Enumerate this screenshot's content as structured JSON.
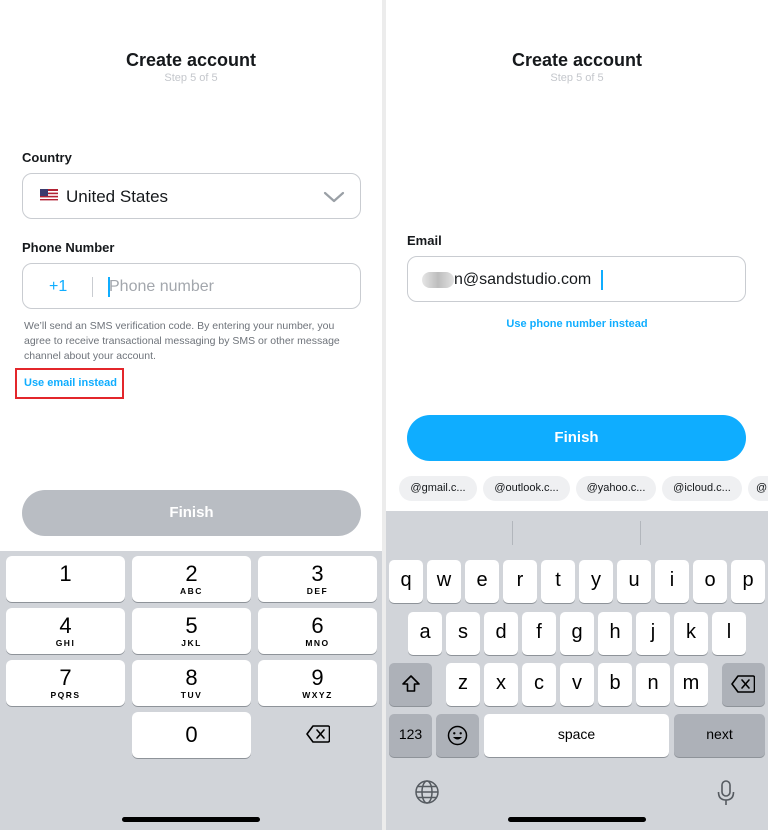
{
  "left": {
    "title": "Create account",
    "subtitle": "Step 5 of 5",
    "country_label": "Country",
    "country_value": "United States",
    "phone_label": "Phone Number",
    "country_code": "+1",
    "phone_placeholder": "Phone number",
    "sms_note": "We’ll send an SMS verification code. By entering your number, you agree to receive transactional messaging by SMS or other message channel about your account.",
    "use_email_link": "Use email instead",
    "finish_label": "Finish",
    "numpad": [
      {
        "num": "1",
        "letters": ""
      },
      {
        "num": "2",
        "letters": "ABC"
      },
      {
        "num": "3",
        "letters": "DEF"
      },
      {
        "num": "4",
        "letters": "GHI"
      },
      {
        "num": "5",
        "letters": "JKL"
      },
      {
        "num": "6",
        "letters": "MNO"
      },
      {
        "num": "7",
        "letters": "PQRS"
      },
      {
        "num": "8",
        "letters": "TUV"
      },
      {
        "num": "9",
        "letters": "WXYZ"
      },
      {
        "num": "0",
        "letters": ""
      }
    ]
  },
  "right": {
    "title": "Create account",
    "subtitle": "Step 5 of 5",
    "email_label": "Email",
    "email_value": "n@sandstudio.com",
    "use_phone_link": "Use phone number instead",
    "finish_label": "Finish",
    "domain_suggestions": [
      "@gmail.c...",
      "@outlook.c...",
      "@yahoo.c...",
      "@icloud.c...",
      "@"
    ],
    "keyboard": {
      "row1": [
        "q",
        "w",
        "e",
        "r",
        "t",
        "y",
        "u",
        "i",
        "o",
        "p"
      ],
      "row2": [
        "a",
        "s",
        "d",
        "f",
        "g",
        "h",
        "j",
        "k",
        "l"
      ],
      "row3": [
        "z",
        "x",
        "c",
        "v",
        "b",
        "n",
        "m"
      ],
      "numbers_key": "123",
      "space_key": "space",
      "return_key": "next"
    }
  },
  "colors": {
    "accent": "#0fadff",
    "finish_disabled": "#b9bdc3",
    "highlight_box": "#e3262b",
    "keyboard_bg": "#d1d4d9"
  }
}
